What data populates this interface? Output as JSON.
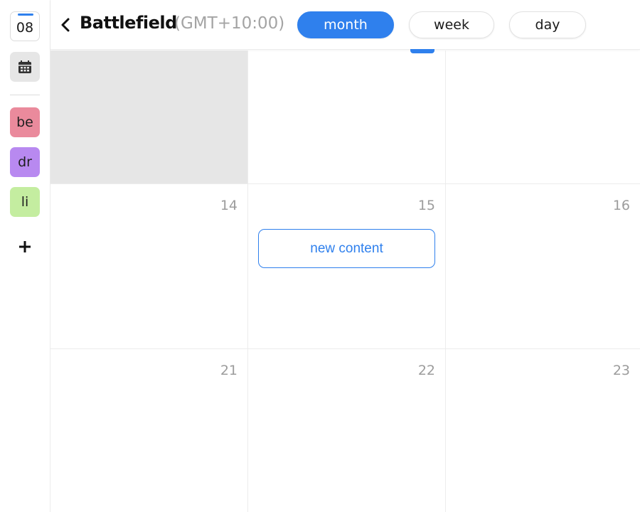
{
  "sidebar": {
    "date_chip": "08",
    "calendars": [
      {
        "label": "be",
        "color": "#ea8a9c"
      },
      {
        "label": "dr",
        "color": "#b889f0"
      },
      {
        "label": "li",
        "color": "#c4eda0"
      }
    ]
  },
  "header": {
    "title": "Battlefield",
    "timezone": "(GMT+10:00)",
    "views": [
      "month",
      "week",
      "day"
    ],
    "active_view": "month"
  },
  "calendar": {
    "weeks": [
      [
        "",
        "",
        ""
      ],
      [
        "14",
        "15",
        "16"
      ],
      [
        "21",
        "22",
        "23"
      ]
    ],
    "event": {
      "label": "new content",
      "day": "15"
    }
  },
  "colors": {
    "accent": "#2f80ed",
    "muted_cell": "#e6e6e6"
  }
}
